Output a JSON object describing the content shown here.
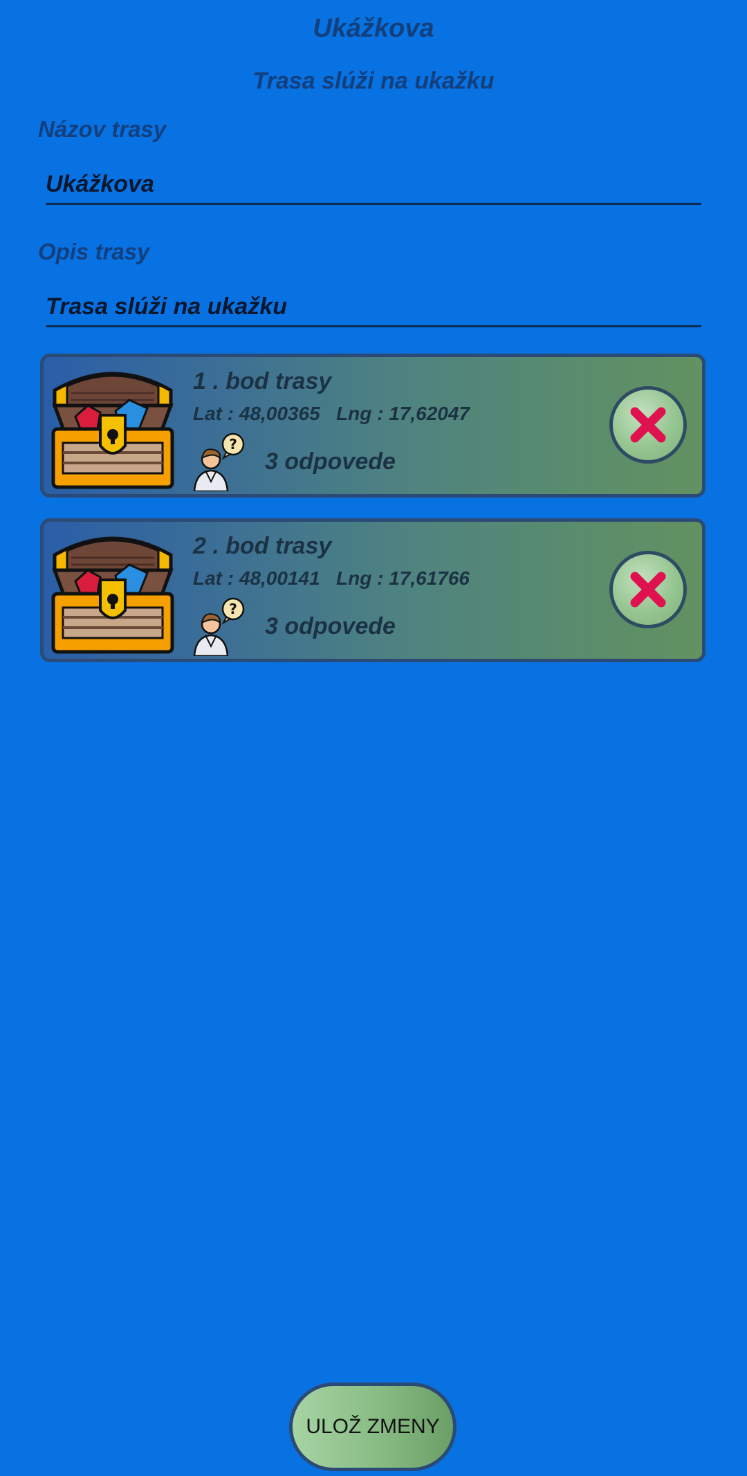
{
  "header": {
    "title": "Ukážkova",
    "subtitle": "Trasa slúži na ukažku"
  },
  "form": {
    "name_label": "Názov trasy",
    "name_value": "Ukážkova",
    "desc_label": "Opis trasy",
    "desc_value": "Trasa slúži na ukažku"
  },
  "points": [
    {
      "title": "1 . bod trasy",
      "coords": "Lat : 48,00365   Lng : 17,62047",
      "answers": "3 odpovede",
      "icon": "treasure-chest-icon",
      "person_icon": "person-question-icon",
      "delete_icon": "close-icon"
    },
    {
      "title": "2 . bod trasy",
      "coords": "Lat : 48,00141   Lng : 17,61766",
      "answers": "3 odpovede",
      "icon": "treasure-chest-icon",
      "person_icon": "person-question-icon",
      "delete_icon": "close-icon"
    }
  ],
  "save_button": {
    "label": "ULOŽ ZMENY"
  },
  "colors": {
    "background": "#0872e3",
    "heading": "#123f7d",
    "delete_x": "#e0114f"
  }
}
